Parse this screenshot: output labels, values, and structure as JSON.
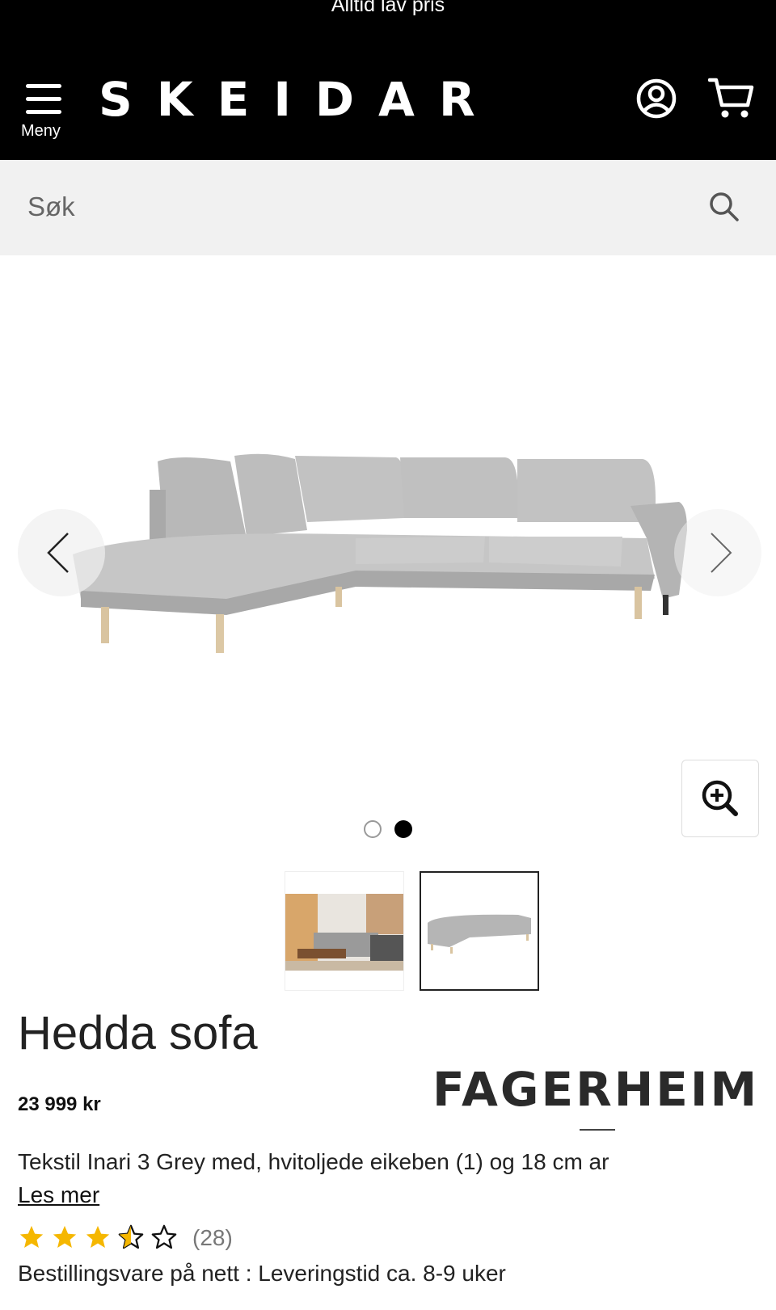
{
  "promo_text": "Alltid lav pris",
  "header": {
    "menu_label": "Meny",
    "logo_text": "SKEIDAR",
    "icons": {
      "menu": "hamburger-icon",
      "account": "user-circle-icon",
      "cart": "cart-icon"
    }
  },
  "search": {
    "placeholder": "Søk",
    "icon": "search-icon"
  },
  "gallery": {
    "image_count": 2,
    "active_index": 2,
    "icons": {
      "prev": "chevron-left-icon",
      "next": "chevron-right-icon",
      "zoom": "zoom-in-icon"
    }
  },
  "product": {
    "title": "Hedda sofa",
    "brand": "FAGERHEIM",
    "price": "23 999 kr",
    "description": "Tekstil Inari 3 Grey med, hvitoljede eikeben (1) og 18 cm ar",
    "read_more": "Les mer",
    "rating": 3.5,
    "rating_max": 5,
    "review_count": "(28)",
    "delivery": "Bestillingsvare på nett : Leveringstid ca. 8-9 uker"
  },
  "colors": {
    "header_bg": "#000000",
    "search_bg": "#f1f1f1",
    "star": "#f5b700"
  }
}
